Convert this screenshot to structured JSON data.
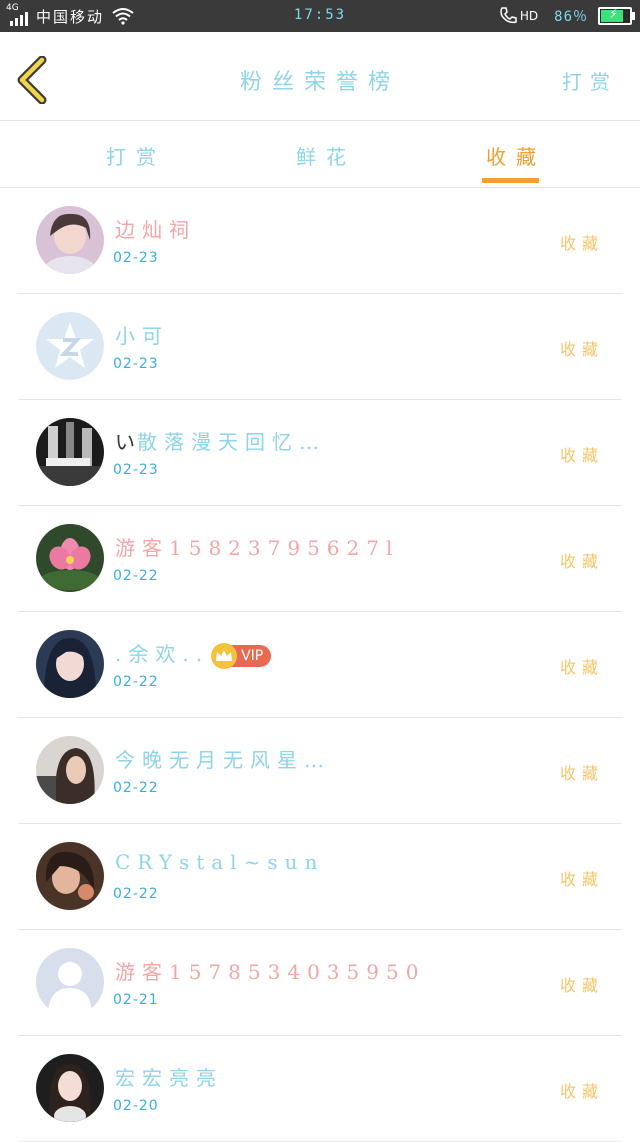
{
  "status_bar": {
    "network": "4G",
    "carrier": "中国移动",
    "time": "17:53",
    "call_label": "HD",
    "battery_text": "86％",
    "battery_level": 0.86
  },
  "header": {
    "back_icon": "chevron-left-icon",
    "title": "粉丝荣誉榜",
    "action_label": "打赏"
  },
  "tabs": [
    {
      "label": "打赏",
      "active": false
    },
    {
      "label": "鲜花",
      "active": false
    },
    {
      "label": "收藏",
      "active": true
    }
  ],
  "colors": {
    "accent_blue": "#8ed4ea",
    "active_tab": "#f0a030",
    "action_yellow": "#f3c66a",
    "date_blue": "#3aaee0",
    "vip_red": "#e86a52"
  },
  "list": [
    {
      "name": "边灿祠",
      "date": "02-23",
      "action": "收藏"
    },
    {
      "name": "小可",
      "date": "02-23",
      "action": "收藏"
    },
    {
      "name_prefix": "い",
      "name": "散落漫天回忆…",
      "date": "02-23",
      "action": "收藏"
    },
    {
      "name": "游客15823795627l",
      "date": "02-22",
      "action": "收藏"
    },
    {
      "name": ".余欢..",
      "vip_label": "VIP",
      "date": "02-22",
      "action": "收藏"
    },
    {
      "name": "今晚无月无风星…",
      "date": "02-22",
      "action": "收藏"
    },
    {
      "name": "CRYstal~sun",
      "date": "02-22",
      "action": "收藏"
    },
    {
      "name": "游客1578534035950",
      "date": "02-21",
      "action": "收藏"
    },
    {
      "name": "宏宏亮亮",
      "date": "02-20",
      "action": "收藏"
    }
  ]
}
